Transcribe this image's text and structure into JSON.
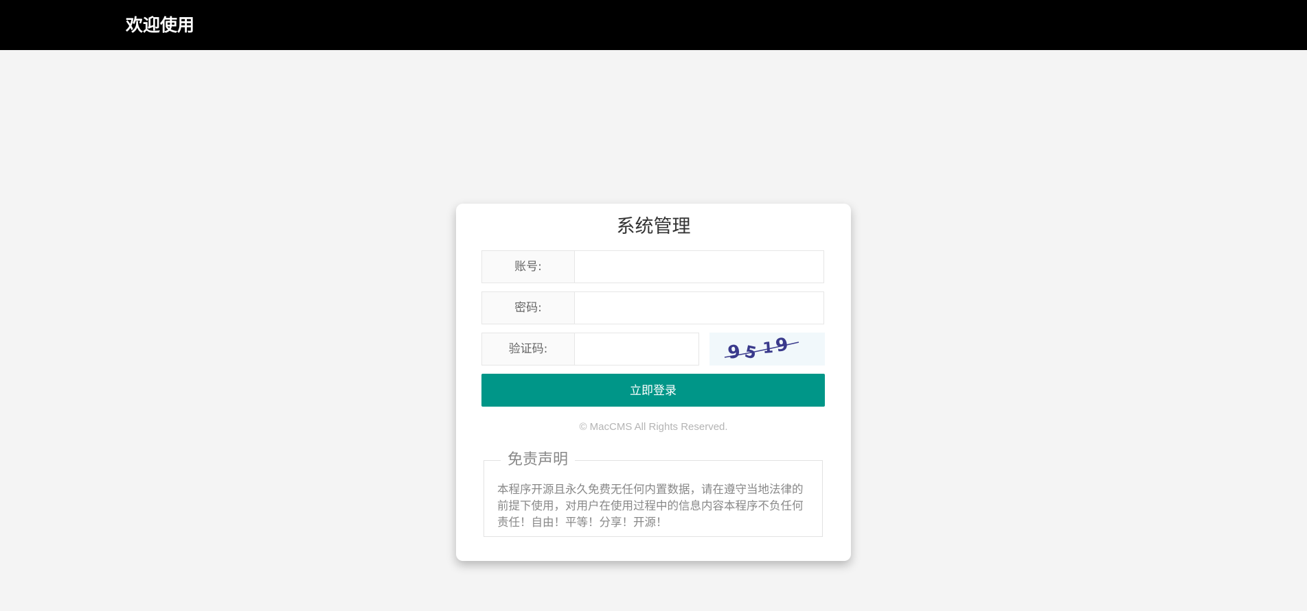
{
  "header": {
    "brand": "欢迎使用"
  },
  "login": {
    "title": "系统管理",
    "username_label": "账号:",
    "password_label": "密码:",
    "captcha_label": "验证码:",
    "captcha_text": "9519",
    "submit_label": "立即登录",
    "copyright": "© MacCMS All Rights Reserved."
  },
  "disclaimer": {
    "title": "免责声明",
    "body": "本程序开源且永久免费无任何内置数据，请在遵守当地法律的前提下使用，对用户在使用过程中的信息内容本程序不负任何责任！自由！平等！分享！开源！"
  },
  "colors": {
    "topbar": "#000000",
    "primary_button": "#009688",
    "captcha_ink": "#3a3a8c"
  }
}
